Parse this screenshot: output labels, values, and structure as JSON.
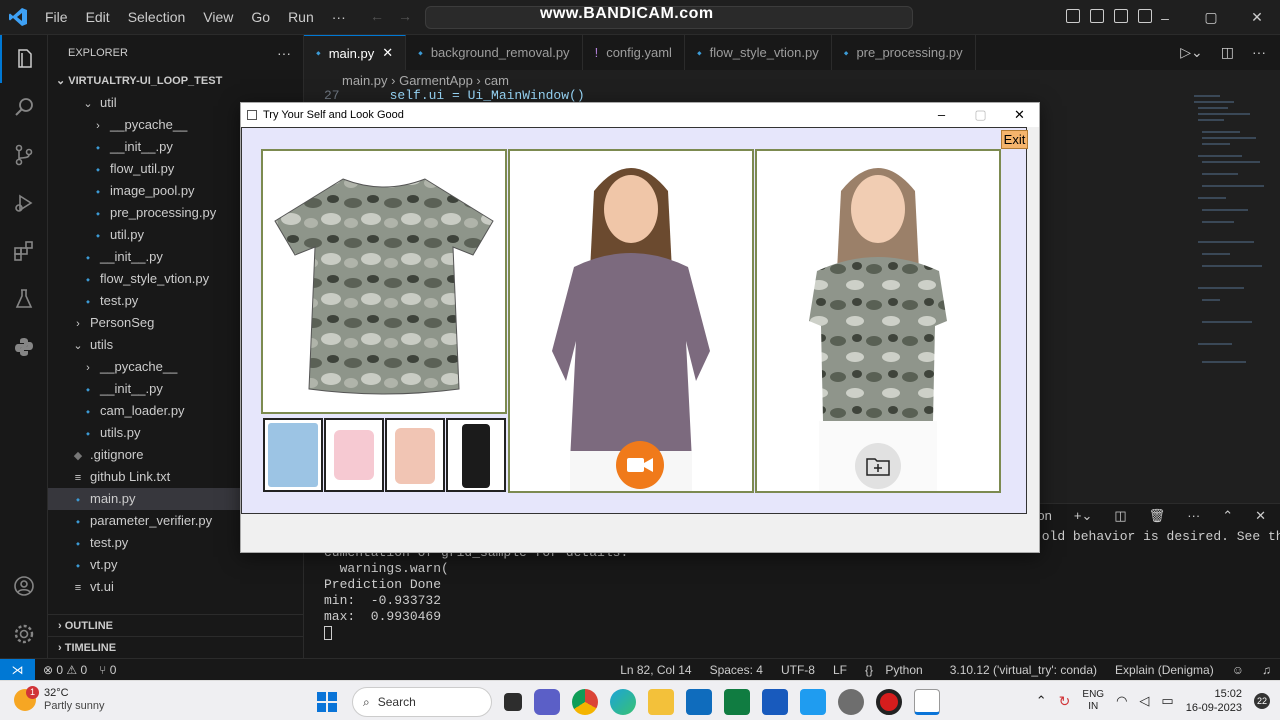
{
  "titlebar": {
    "menu": [
      "File",
      "Edit",
      "Selection",
      "View",
      "Go",
      "Run",
      "···"
    ],
    "watermark": "www.BANDICAM.com",
    "window_controls": [
      "–",
      "▢",
      "✕"
    ]
  },
  "explorer": {
    "title": "EXPLORER",
    "more": "···",
    "root": "VIRTUALTRY-UI_LOOP_TEST",
    "items": [
      {
        "label": "util",
        "indent": 1,
        "kind": "folder-open"
      },
      {
        "label": "__pycache__",
        "indent": 2,
        "kind": "folder"
      },
      {
        "label": "__init__.py",
        "indent": 2,
        "kind": "py"
      },
      {
        "label": "flow_util.py",
        "indent": 2,
        "kind": "py"
      },
      {
        "label": "image_pool.py",
        "indent": 2,
        "kind": "py"
      },
      {
        "label": "pre_processing.py",
        "indent": 2,
        "kind": "py"
      },
      {
        "label": "util.py",
        "indent": 2,
        "kind": "py"
      },
      {
        "label": "__init__.py",
        "indent": 1,
        "kind": "py"
      },
      {
        "label": "flow_style_vtion.py",
        "indent": 1,
        "kind": "py"
      },
      {
        "label": "test.py",
        "indent": 1,
        "kind": "py"
      },
      {
        "label": "PersonSeg",
        "indent": 0,
        "kind": "folder"
      },
      {
        "label": "utils",
        "indent": 0,
        "kind": "folder-open"
      },
      {
        "label": "__pycache__",
        "indent": 1,
        "kind": "folder"
      },
      {
        "label": "__init__.py",
        "indent": 1,
        "kind": "py"
      },
      {
        "label": "cam_loader.py",
        "indent": 1,
        "kind": "py"
      },
      {
        "label": "utils.py",
        "indent": 1,
        "kind": "py"
      },
      {
        "label": ".gitignore",
        "indent": 0,
        "kind": "git"
      },
      {
        "label": "github Link.txt",
        "indent": 0,
        "kind": "txt"
      },
      {
        "label": "main.py",
        "indent": 0,
        "kind": "py",
        "selected": true
      },
      {
        "label": "parameter_verifier.py",
        "indent": 0,
        "kind": "py"
      },
      {
        "label": "test.py",
        "indent": 0,
        "kind": "py"
      },
      {
        "label": "vt.py",
        "indent": 0,
        "kind": "py"
      },
      {
        "label": "vt.ui",
        "indent": 0,
        "kind": "txt"
      }
    ],
    "outline": "OUTLINE",
    "timeline": "TIMELINE"
  },
  "tabs": [
    {
      "label": "main.py",
      "active": true,
      "icon": "python-icon"
    },
    {
      "label": "background_removal.py",
      "icon": "python-icon"
    },
    {
      "label": "config.yaml",
      "icon": "yaml-icon"
    },
    {
      "label": "flow_style_vtion.py",
      "icon": "python-icon"
    },
    {
      "label": "pre_processing.py",
      "icon": "python-icon"
    }
  ],
  "breadcrumb": {
    "file": "main.py",
    "class": "GarmentApp",
    "member": "cam"
  },
  "editor": {
    "line_number": "27",
    "code": "self.ui = Ui_MainWindow()"
  },
  "panel": {
    "shell": "python"
  },
  "terminal": {
    "lines": [
      "or has changed to align_corners=False since 1.3.0. Please specify align_corners=True if the old behavior is desired. See the do",
      "cumentation of grid_sample for details.",
      "  warnings.warn(",
      "Prediction Done",
      "min:  -0.933732",
      "max:  0.9930469"
    ]
  },
  "statusbar": {
    "errors": "⊗ 0 ⚠ 0",
    "ports": "⑂ 0",
    "position": "Ln 82, Col 14",
    "spaces": "Spaces: 4",
    "encoding": "UTF-8",
    "eol": "LF",
    "language": "Python",
    "interpreter": "3.10.12 ('virtual_try': conda)",
    "explain": "Explain (Denigma)"
  },
  "app": {
    "title": "Try Your Self and Look Good",
    "exit_label": "Exit",
    "window_controls": [
      "–",
      "▢",
      "✕"
    ]
  },
  "taskbar": {
    "weather_badge": "1",
    "temp": "32°C",
    "condition": "Partly sunny",
    "search": "Search",
    "lang1": "ENG",
    "lang2": "IN",
    "time": "15:02",
    "date": "16-09-2023",
    "notif": "22"
  },
  "colors": {
    "accent": "#0078d4",
    "exit_button": "#f5b46c",
    "camera_button": "#f07a1a",
    "panel_border": "#7c8a50"
  }
}
